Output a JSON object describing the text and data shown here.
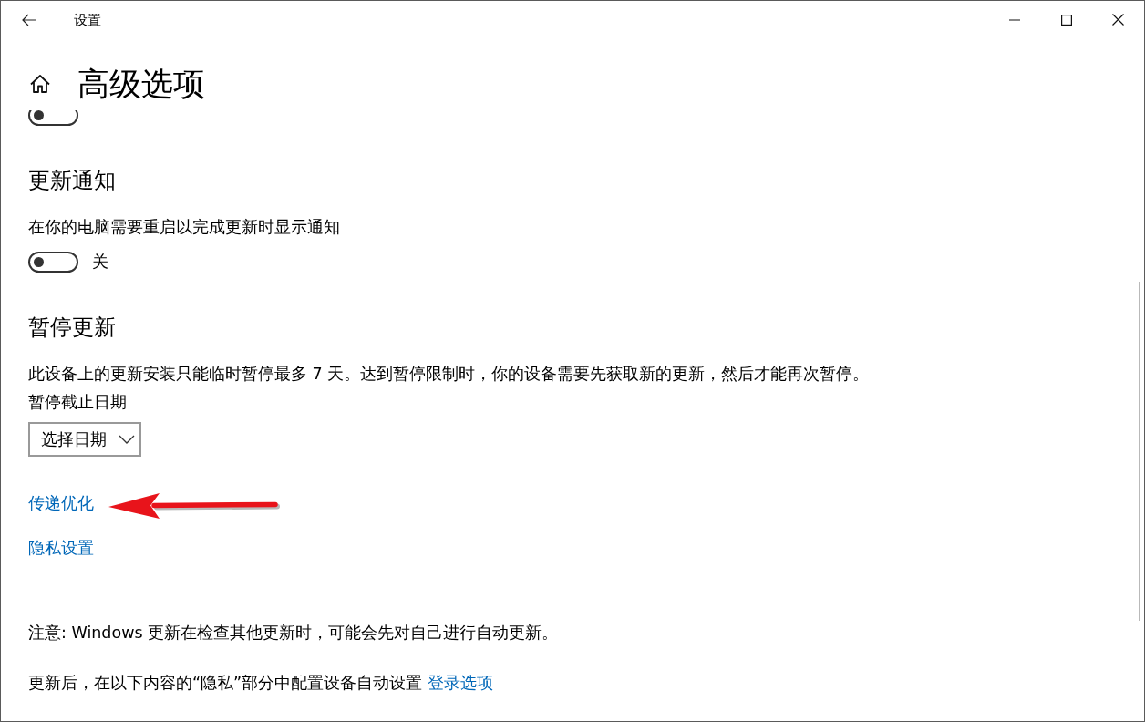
{
  "window": {
    "title": "设置"
  },
  "page": {
    "title": "高级选项"
  },
  "content": [
    {
      "kind": "toggle",
      "on": false
    },
    {
      "kind": "heading",
      "text": "更新通知"
    },
    {
      "kind": "text",
      "text": "在你的电脑需要重启以完成更新时显示通知"
    },
    {
      "kind": "toggle",
      "on": false,
      "label": "关"
    },
    {
      "kind": "heading",
      "text": "暂停更新"
    },
    {
      "kind": "text",
      "text": "此设备上的更新安装只能临时暂停最多 7 天。达到暂停限制时，你的设备需要先获取新的更新，然后才能再次暂停。"
    },
    {
      "kind": "label",
      "text": "暂停截止日期"
    },
    {
      "kind": "dropdown",
      "value": "选择日期"
    },
    {
      "kind": "link",
      "text": "传递优化"
    },
    {
      "kind": "link",
      "text": "隐私设置"
    },
    {
      "kind": "text",
      "text": "注意: Windows 更新在检查其他更新时，可能会先对自己进行自动更新。"
    },
    {
      "kind": "text_link",
      "text": "更新后，在以下内容的“隐私”部分中配置设备自动设置",
      "link": "登录选项"
    }
  ]
}
